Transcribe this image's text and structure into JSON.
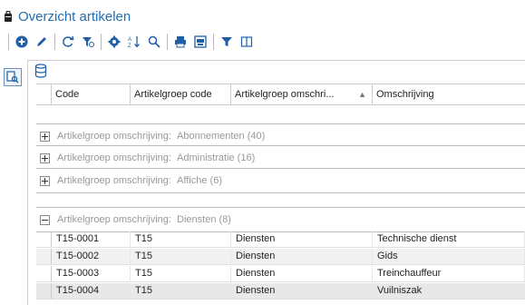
{
  "title": "Overzicht artikelen",
  "toolbar": [
    {
      "icon": "add-icon"
    },
    {
      "icon": "edit-icon"
    },
    {
      "sep": true
    },
    {
      "icon": "refresh-icon"
    },
    {
      "icon": "clear-filter-icon"
    },
    {
      "sep": true
    },
    {
      "icon": "settings-icon"
    },
    {
      "icon": "sort-az-icon"
    },
    {
      "icon": "search-icon"
    },
    {
      "sep": true
    },
    {
      "icon": "print-icon"
    },
    {
      "icon": "print-preview-icon"
    },
    {
      "sep": true
    },
    {
      "icon": "filter-icon"
    },
    {
      "icon": "columns-icon"
    }
  ],
  "columns": [
    "Code",
    "Artikelgroep code",
    "Artikelgroep omschri...",
    "Omschrijving"
  ],
  "groups": [
    {
      "label": "Artikelgroep omschrijving:",
      "value": "Abonnementen (40)",
      "expanded": false
    },
    {
      "label": "Artikelgroep omschrijving:",
      "value": "Administratie (16)",
      "expanded": false
    },
    {
      "label": "Artikelgroep omschrijving:",
      "value": "Affiche (6)",
      "expanded": false
    },
    {
      "label": "Artikelgroep omschrijving:",
      "value": "Diensten (8)",
      "expanded": true
    }
  ],
  "rows": [
    [
      "T15-0001",
      "T15",
      "Diensten",
      "Technische dienst"
    ],
    [
      "T15-0002",
      "T15",
      "Diensten",
      "Gids"
    ],
    [
      "T15-0003",
      "T15",
      "Diensten",
      "Treinchauffeur"
    ],
    [
      "T15-0004",
      "T15",
      "Diensten",
      "Vuilniszak"
    ]
  ],
  "colors": {
    "title": "#1e6fb5",
    "icon_blue": "#1e5fa8",
    "icon_dark": "#333333"
  }
}
